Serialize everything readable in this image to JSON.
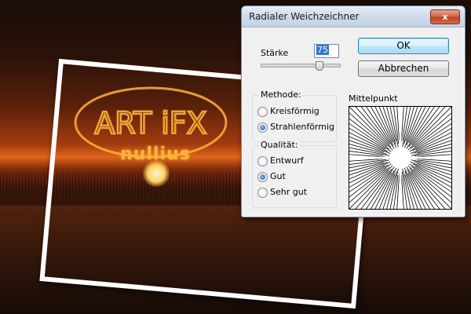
{
  "window": {
    "title": "Radialer Weichzeichner",
    "close_label": "x"
  },
  "staerke": {
    "label": "Stärke",
    "value": "75",
    "slider_fraction": 0.75
  },
  "buttons": {
    "ok_label": "OK",
    "cancel_label": "Abbrechen"
  },
  "methode": {
    "title": "Methode:",
    "options": [
      {
        "label": "Kreisförmig",
        "selected": false
      },
      {
        "label": "Strahlenförmig",
        "selected": true
      }
    ]
  },
  "qualitaet": {
    "title": "Qualität:",
    "options": [
      {
        "label": "Entwurf",
        "selected": false
      },
      {
        "label": "Gut",
        "selected": true
      },
      {
        "label": "Sehr gut",
        "selected": false
      }
    ]
  },
  "preview": {
    "label": "Mittelpunkt"
  },
  "background": {
    "logo_top": "ART iFX",
    "logo_tagline": "nullius"
  },
  "colors": {
    "accent": "#3377d6",
    "logo": "#ffb23a"
  }
}
